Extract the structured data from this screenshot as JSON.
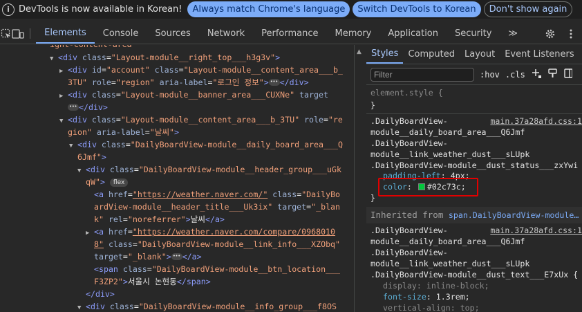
{
  "infobar": {
    "icon": "info-icon",
    "message": "DevTools is now available in Korean!",
    "buttons": [
      "Always match Chrome's language",
      "Switch DevTools to Korean",
      "Don't show again"
    ]
  },
  "toolbar": {
    "tabs": [
      "Elements",
      "Console",
      "Sources",
      "Network",
      "Performance",
      "Memory",
      "Application",
      "Security"
    ],
    "active_tab": "Elements",
    "more": "≫",
    "icons": [
      "inspect-icon",
      "device-toolbar-icon",
      "settings-icon",
      "more-vert-icon"
    ]
  },
  "elements_panel": {
    "line0": "ight-content-area",
    "l1": {
      "tag_open": "<div",
      "attr1": "class",
      "val1": "\"Layout-module__right_top___h3g3v\"",
      "tag_close": ">"
    },
    "l2": {
      "tag_open": "<div",
      "attr1": "id",
      "val1": "\"account\"",
      "attr2": "class",
      "val2": "\"Layout-module__content_area___b_"
    },
    "l3": {
      "val_cont": "3TU\"",
      "attr1": "role",
      "val1": "\"region\"",
      "attr2": "aria-label",
      "val2": "\"로그인 정보\"",
      "close": ">",
      "end": "</div>"
    },
    "l4": {
      "tag_open": "<div",
      "attr1": "class",
      "val1": "\"Layout-module__banner_area___CUXNe\"",
      "attr2": "target"
    },
    "l5": {
      "end": "</div>"
    },
    "l6": {
      "tag_open": "<div",
      "attr1": "class",
      "val1": "\"Layout-module__content_area___b_3TU\"",
      "attr2": "role",
      "val2": "\"re"
    },
    "l7": {
      "val_cont": "gion\"",
      "attr1": "aria-label",
      "val1": "\"날씨\"",
      "close": ">"
    },
    "l8": {
      "tag_open": "<div",
      "attr1": "class",
      "val1": "\"DailyBoardView-module__daily_board_area___Q"
    },
    "l9": {
      "val_cont": "6Jmf\"",
      "close": ">"
    },
    "l10": {
      "tag_open": "<div",
      "attr1": "class",
      "val1": "\"DailyBoardView-module__header_group___uGk"
    },
    "l11": {
      "val_cont": "qW\"",
      "close": ">",
      "badge": "flex"
    },
    "l12": {
      "tag_open": "<a",
      "attr1": "href",
      "val1": "\"https://weather.naver.com/\"",
      "attr2": "class",
      "val2": "\"DailyBo"
    },
    "l13": {
      "val_cont": "ardView-module__header_title___Uk3ix\"",
      "attr1": "target",
      "val1": "\"_blan"
    },
    "l14": {
      "val_cont": "k\"",
      "attr1": "rel",
      "val1": "\"noreferrer\"",
      "close": ">",
      "text": "날씨",
      "end": "</a>"
    },
    "l15": {
      "tag_open": "<a",
      "attr1": "href",
      "val1": "\"https://weather.naver.com/compare/0968010"
    },
    "l16": {
      "val_cont": "8\"",
      "attr1": "class",
      "val1": "\"DailyBoardView-module__link_info___XZObq\""
    },
    "l17": {
      "attr1": "target",
      "val1": "\"_blank\"",
      "close": ">",
      "end": "</a>"
    },
    "l18": {
      "tag_open": "<span",
      "attr1": "class",
      "val1": "\"DailyBoardView-module__btn_location___"
    },
    "l19": {
      "val_cont": "F3ZP2\"",
      "close": ">",
      "text": "서울시 논현동",
      "end": "</span>"
    },
    "l20": {
      "end": "</div>"
    },
    "l21": {
      "tag_open": "<div",
      "attr1": "class",
      "val1": "\"DailyBoardView-module__info_group___f8OS"
    }
  },
  "styles_panel": {
    "tabs": [
      "Styles",
      "Computed",
      "Layout",
      "Event Listeners"
    ],
    "active_tab": "Styles",
    "filter_placeholder": "Filter",
    "hov": ":hov",
    "cls": ".cls",
    "element_style": "element.style {",
    "close_brace": "}",
    "rule1": {
      "selectors": [
        ".DailyBoardView-",
        "module__daily_board_area___Q6Jmf",
        ".DailyBoardView-",
        "module__link_weather_dust___sLUpk",
        ".DailyBoardView-module__dust_status___zxYwi"
      ],
      "source": "main.37a28afd.css:1",
      "props": [
        {
          "name": "padding-left",
          "value": "4px;"
        },
        {
          "name": "color",
          "value": "#02c73c;",
          "swatch": "#02c73c"
        }
      ]
    },
    "inherited": {
      "label": "Inherited from",
      "link": "span.DailyBoardView-module…"
    },
    "rule2": {
      "selectors": [
        ".DailyBoardView-",
        "module__daily_board_area___Q6Jmf",
        ".DailyBoardView-",
        "module__link_weather_dust___sLUpk",
        ".DailyBoardView-module__dust_text___E7xUx {"
      ],
      "source": "main.37a28afd.css:1",
      "props": [
        {
          "name": "display",
          "value": "inline-block;",
          "dim": true
        },
        {
          "name": "font-size",
          "value": "1.3rem;"
        },
        {
          "name": "vertical-align",
          "value": "top;",
          "dim": true
        }
      ]
    }
  }
}
